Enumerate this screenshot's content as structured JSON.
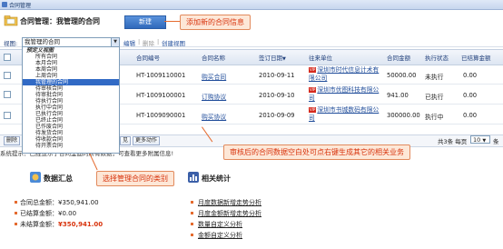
{
  "window": {
    "title": "合同管理"
  },
  "header": {
    "title": "合同管理：我管理的合同",
    "new_button": "新建",
    "callout_new": "添加新的合同信息"
  },
  "view": {
    "label": "视图:",
    "selected": "我管理的合同",
    "edit": "编辑",
    "delete": "删除",
    "create": "创建视图"
  },
  "dropdown": {
    "group": "预定义视图",
    "items": [
      "所有合同",
      "本月合同",
      "本周合同",
      "上周合同",
      "我管理的合同",
      "待审核合同",
      "待审批合同",
      "待执行合同",
      "执行中合同",
      "已执行合同",
      "已终止合同",
      "已作废合同",
      "待发货合同",
      "待收款合同",
      "待开票合同"
    ],
    "selected_index": 4
  },
  "table": {
    "columns": [
      "合同编号",
      "合同名称",
      "签订日期",
      "往来单位",
      "合同金额",
      "执行状态",
      "已结算金额"
    ],
    "sort_marker": "▼",
    "rows": [
      {
        "no": "HT-1009110001",
        "name": "购买合同",
        "date": "2010-09-11",
        "tag": "VIP",
        "company": "深圳市时代信息计术有限公司",
        "amount": "50000.00",
        "status": "未执行",
        "settled": "0.00"
      },
      {
        "no": "HT-1009100001",
        "name": "订购协议",
        "date": "2010-09-10",
        "tag": "VIP",
        "company": "深圳市优图科技有限公司",
        "amount": "941.00",
        "status": "已执行",
        "settled": "0.00"
      },
      {
        "no": "HT-1009090001",
        "name": "购买协议",
        "date": "2010-09-09",
        "tag": "VIP",
        "company": "深圳市书城数码有限公司",
        "amount": "300000.00",
        "status": "执行中",
        "settled": "0.00"
      }
    ]
  },
  "footer": {
    "delete_btn": "删除",
    "view_btn": "见",
    "more_btn": "更多动作",
    "total_text": "共3条 每页",
    "per_page": "10",
    "per_page_arrow": "▼",
    "pages_text": "条",
    "hint": "系统提示：已经显示了合同里面的所有数据，可查看更多附属信息!",
    "callout_right": "审核后的合同数据空白处可点右键生成其它的相关业务",
    "callout_left": "选择管理合同的类别"
  },
  "summary": {
    "title": "数据汇总",
    "total": "合同总金额：¥350,941.00",
    "settled": "已结算金额：¥0.00",
    "unsettled_label": "未结算金额：",
    "unsettled_value": "¥350,941.00"
  },
  "stats": {
    "title": "相关统计",
    "links": [
      "月度数据新增走势分析",
      "月度金额新增走势分析",
      "数量自定义分析",
      "金额自定义分析"
    ]
  },
  "colors": {
    "accent": "#316ac5",
    "callout_text": "#d8330c",
    "callout_bg": "#fde7d7",
    "vip_tag": "#d52b1e"
  }
}
